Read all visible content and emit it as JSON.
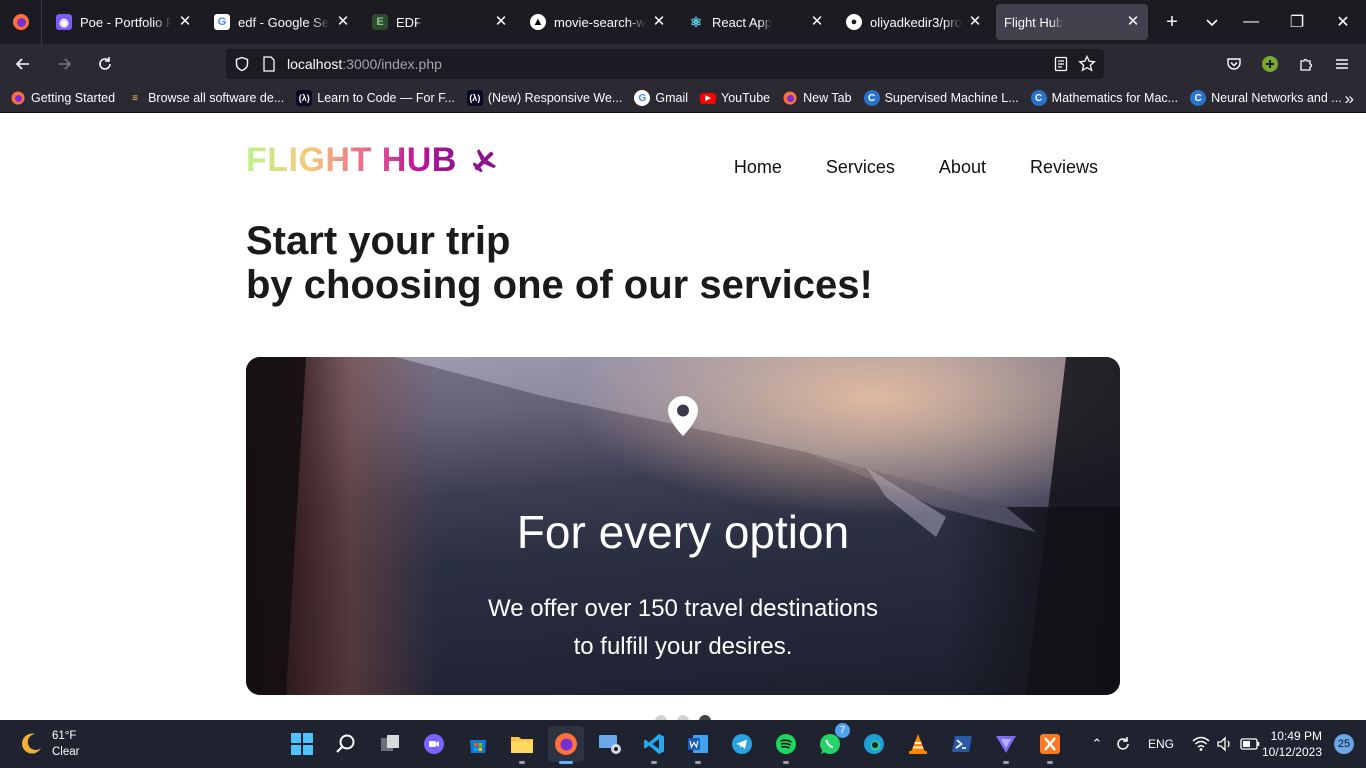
{
  "browser": {
    "tabs": [
      {
        "label": "Poe - Portfolio Pr",
        "favicon": "poe-icon",
        "color": "#7b5cf0"
      },
      {
        "label": "edf - Google Searc",
        "favicon": "google-icon",
        "color": "#ffffff"
      },
      {
        "label": "EDF",
        "favicon": "edf-icon",
        "color": "#2e4a2e"
      },
      {
        "label": "movie-search-wel",
        "favicon": "vercel-icon",
        "color": "#ffffff"
      },
      {
        "label": "React App",
        "favicon": "react-icon",
        "color": "#61dafb"
      },
      {
        "label": "oliyadkedir3/prot",
        "favicon": "github-icon",
        "color": "#ffffff"
      },
      {
        "label": "Flight Hub",
        "favicon": "",
        "color": "#42414d",
        "active": true
      }
    ],
    "url": {
      "host": "localhost",
      "rest": ":3000/index.php"
    },
    "bookmarks": [
      {
        "label": "Getting Started",
        "icon": "firefox-icon"
      },
      {
        "label": "Browse all software de...",
        "icon": "software-icon"
      },
      {
        "label": "Learn to Code — For F...",
        "icon": "freecodecamp-icon"
      },
      {
        "label": "(New) Responsive We...",
        "icon": "freecodecamp-icon"
      },
      {
        "label": "Gmail",
        "icon": "google-icon"
      },
      {
        "label": "YouTube",
        "icon": "youtube-icon"
      },
      {
        "label": "New Tab",
        "icon": "firefox-icon"
      },
      {
        "label": "Supervised Machine L...",
        "icon": "coursera-icon"
      },
      {
        "label": "Mathematics for Mac...",
        "icon": "coursera-icon"
      },
      {
        "label": "Neural Networks and ...",
        "icon": "coursera-icon"
      }
    ]
  },
  "site": {
    "logo": "FLIGHT HUB",
    "nav": [
      "Home",
      "Services",
      "About",
      "Reviews"
    ],
    "hero_line1": "Start your trip",
    "hero_line2": "by choosing one of our services!",
    "card_title": "For every option",
    "card_text": "We offer over 150 travel destinations to fulfill your desires.",
    "carousel": {
      "count": 3,
      "active": 3
    }
  },
  "taskbar": {
    "temperature": "61°F",
    "condition": "Clear",
    "language": "ENG",
    "time": "10:49 PM",
    "date": "10/12/2023",
    "notifications": "25",
    "whatsapp_badge": "7"
  }
}
